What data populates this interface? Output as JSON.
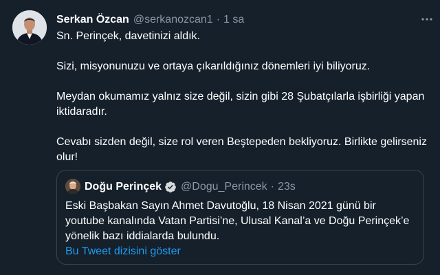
{
  "tweet": {
    "author_name": "Serkan Özcan",
    "author_handle": "@serkanozcan1",
    "separator": "·",
    "time": "1 sa",
    "more_icon": "more-horizontal-icon",
    "paragraphs": [
      "Sn. Perinçek, davetinizi aldık.",
      "Sizi, misyonunuzu ve ortaya çıkarıldığınız dönemleri iyi biliyoruz.",
      "Meydan okumamız yalnız size değil, sizin gibi 28 Şubatçılarla işbirliği yapan iktidaradır.",
      "Cevabı sizden değil, size rol veren Beştepeden bekliyoruz. Birlikte gelirseniz olur!"
    ]
  },
  "quote": {
    "author_name": "Doğu Perinçek",
    "verified_icon": "verified-badge-icon",
    "author_handle": "@Dogu_Perincek",
    "separator": "·",
    "time": "23s",
    "text": "Eski Başbakan Sayın Ahmet Davutoğlu, 18 Nisan 2021 günü bir youtube kanalında Vatan Partisi’ne, Ulusal Kanal’a ve Doğu Perinçek’e yönelik bazı iddialarda bulundu.",
    "show_thread": "Bu Tweet dizisini göster"
  },
  "colors": {
    "background": "#15202b",
    "text": "#ffffff",
    "secondary": "#8b98a5",
    "link": "#1d9bf0",
    "border": "#38444d"
  }
}
